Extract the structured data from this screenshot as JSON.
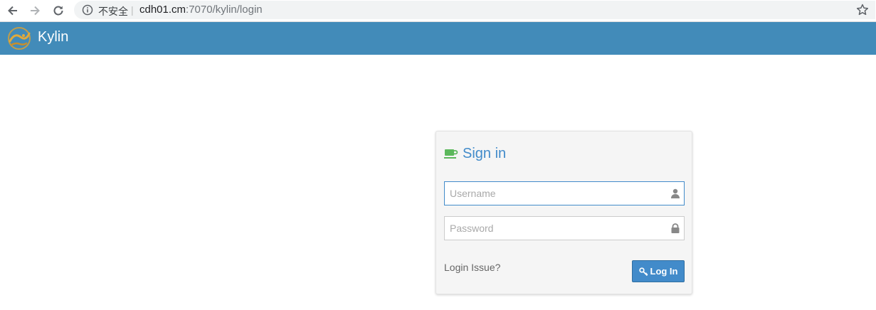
{
  "browser": {
    "security_label": "不安全",
    "separator": "|",
    "url_host": "cdh01.cm",
    "url_rest": ":7070/kylin/login"
  },
  "app": {
    "brand": "Kylin",
    "header_color": "#428bb9"
  },
  "login": {
    "title": "Sign in",
    "username": {
      "value": "",
      "placeholder": "Username",
      "icon": "user-icon"
    },
    "password": {
      "value": "",
      "placeholder": "Password",
      "icon": "lock-icon"
    },
    "issue_link": "Login Issue?",
    "submit_label": "Log In",
    "accent_color": "#428bca"
  }
}
